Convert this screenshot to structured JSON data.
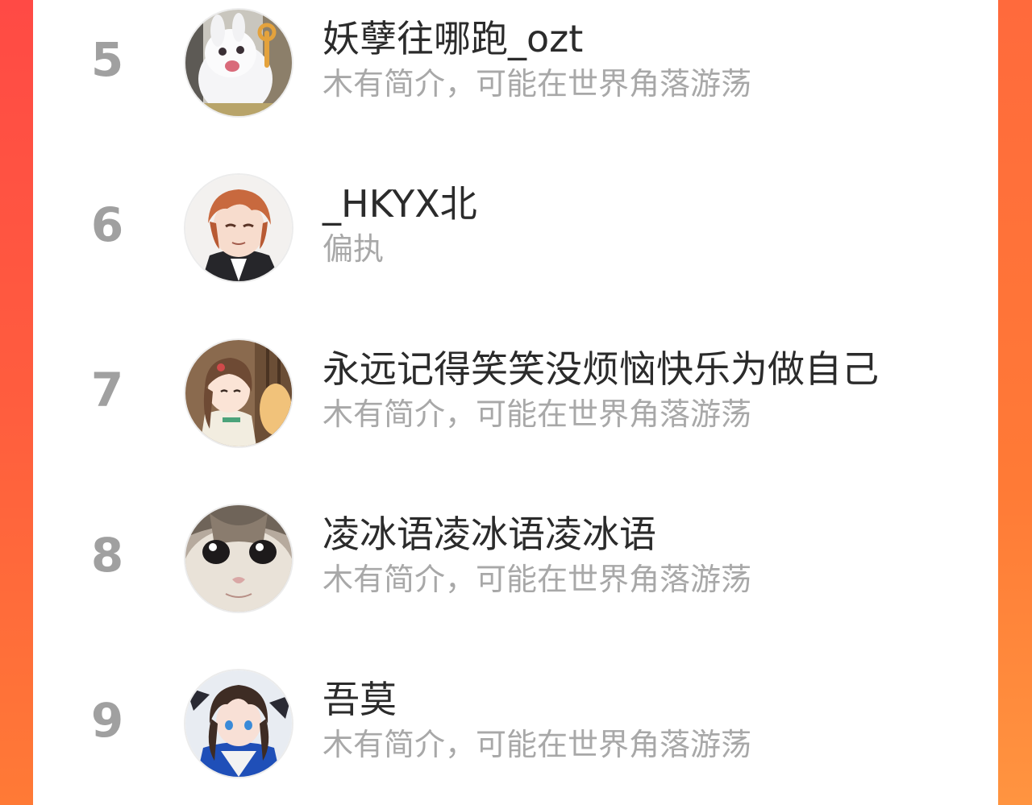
{
  "colors": {
    "rank_gray": "#a0a0a0",
    "bio_gray": "#a8a8a8",
    "name_dark": "#2b2b2b",
    "background_left": "#ff4a45",
    "background_right": "#ff7a36"
  },
  "ranking": [
    {
      "rank": "5",
      "name": "妖孽往哪跑_ozt",
      "bio": "木有简介，可能在世界角落游荡",
      "avatar_icon": "white-rabbit-avatar"
    },
    {
      "rank": "6",
      "name": "_HKYX北",
      "bio": "偏执",
      "avatar_icon": "anime-boy-avatar"
    },
    {
      "rank": "7",
      "name": "永远记得笑笑没烦恼快乐为做自己",
      "bio": "木有简介，可能在世界角落游荡",
      "avatar_icon": "anime-girl-avatar"
    },
    {
      "rank": "8",
      "name": "凌冰语凌冰语凌冰语",
      "bio": "木有简介，可能在世界角落游荡",
      "avatar_icon": "crying-cat-avatar"
    },
    {
      "rank": "9",
      "name": "吾莫",
      "bio": "木有简介，可能在世界角落游荡",
      "avatar_icon": "anime-character-avatar"
    }
  ]
}
